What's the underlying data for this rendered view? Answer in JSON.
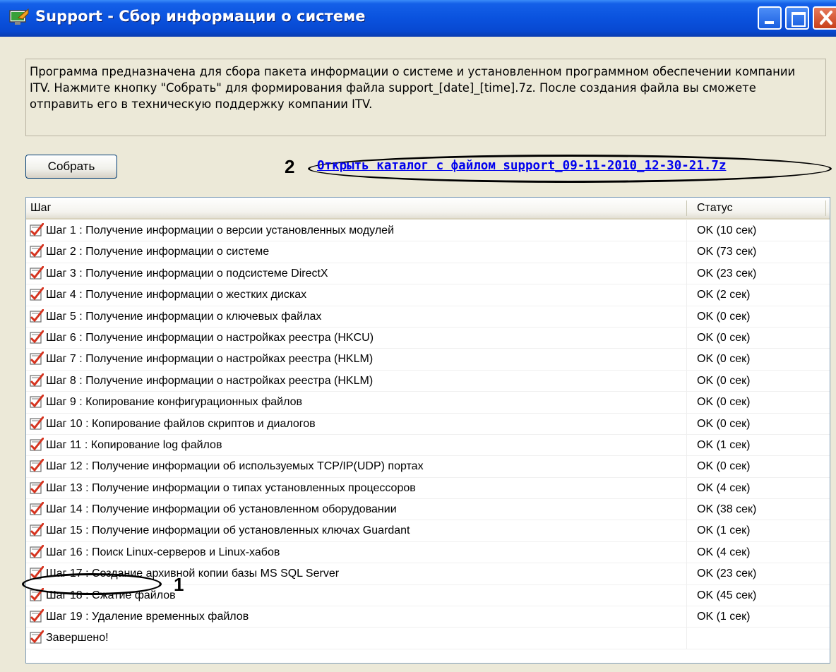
{
  "window": {
    "title": "Support - Сбор информации о системе",
    "icon": "support-app-icon"
  },
  "description": "Программа предназначена для сбора пакета информации о системе и установленном программном обеспечении компании ITV. Нажмите кнопку \"Собрать\" для формирования файла support_[date]_[time].7z. После создания файла вы сможете отправить его в техническую поддержку компании ITV.",
  "collect_button": "Собрать",
  "open_link": "Открыть каталог с файлом support_09-11-2010_12-30-21.7z",
  "annotations": {
    "marker_1": "1",
    "marker_2": "2"
  },
  "table": {
    "headers": {
      "step": "Шаг",
      "status": "Статус"
    },
    "rows": [
      {
        "step": "Шаг 1 : Получение информации о версии установленных модулей",
        "status": "OK (10 сек)"
      },
      {
        "step": "Шаг 2 : Получение информации о системе",
        "status": "OK (73 сек)"
      },
      {
        "step": "Шаг 3 : Получение информации о подсистеме DirectX",
        "status": "OK (23 сек)"
      },
      {
        "step": "Шаг 4 : Получение информации о жестких дисках",
        "status": "OK (2 сек)"
      },
      {
        "step": "Шаг 5 : Получение информации о ключевых файлах",
        "status": "OK (0 сек)"
      },
      {
        "step": "Шаг 6 : Получение информации о настройках реестра (HKCU)",
        "status": "OK (0 сек)"
      },
      {
        "step": "Шаг 7 : Получение информации о настройках реестра (HKLM)",
        "status": "OK (0 сек)"
      },
      {
        "step": "Шаг 8 : Получение информации о настройках реестра (HKLM)",
        "status": "OK (0 сек)"
      },
      {
        "step": "Шаг 9 : Копирование конфигурационных файлов",
        "status": "OK (0 сек)"
      },
      {
        "step": "Шаг 10 : Копирование файлов скриптов и диалогов",
        "status": "OK (0 сек)"
      },
      {
        "step": "Шаг 11 : Копирование log файлов",
        "status": "OK (1 сек)"
      },
      {
        "step": "Шаг 12 : Получение информации об используемых TCP/IP(UDP) портах",
        "status": "OK (0 сек)"
      },
      {
        "step": "Шаг 13 : Получение информации о типах установленных процессоров",
        "status": "OK (4 сек)"
      },
      {
        "step": "Шаг 14 : Получение информации об установленном оборудовании",
        "status": "OK (38 сек)"
      },
      {
        "step": "Шаг 15 : Получение информации об установленных ключах Guardant",
        "status": "OK (1 сек)"
      },
      {
        "step": "Шаг 16 : Поиск Linux-серверов и Linux-хабов",
        "status": "OK (4 сек)"
      },
      {
        "step": "Шаг 17 : Создание архивной копии базы MS SQL Server",
        "status": "OK (23 сек)"
      },
      {
        "step": "Шаг 18 : Сжатие файлов",
        "status": "OK (45 сек)"
      },
      {
        "step": "Шаг 19 : Удаление временных файлов",
        "status": "OK (1 сек)"
      },
      {
        "step": "Завершено!",
        "status": ""
      }
    ]
  },
  "colors": {
    "titlebar": "#0a52de",
    "link": "#0000ee",
    "dialog_bg": "#ece9d8"
  }
}
